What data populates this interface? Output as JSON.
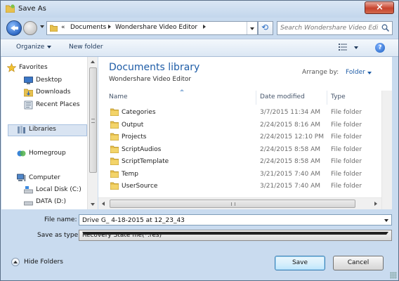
{
  "window": {
    "title": "Save As",
    "close_label": "×"
  },
  "address": {
    "prefix": "«",
    "crumbs": [
      "Documents",
      "Wondershare Video Editor"
    ]
  },
  "search": {
    "placeholder": "Search Wondershare Video Edi..."
  },
  "toolbar": {
    "organize_label": "Organize",
    "new_folder_label": "New folder",
    "help_label": "?"
  },
  "nav": {
    "items": [
      {
        "label": "Favorites",
        "icon": "star-icon"
      },
      {
        "label": "Desktop",
        "icon": "desktop-icon"
      },
      {
        "label": "Downloads",
        "icon": "downloads-folder-icon"
      },
      {
        "label": "Recent Places",
        "icon": "recent-places-icon"
      },
      {
        "label": "Libraries",
        "icon": "libraries-icon"
      },
      {
        "label": "Homegroup",
        "icon": "homegroup-icon"
      },
      {
        "label": "Computer",
        "icon": "computer-icon"
      },
      {
        "label": "Local Disk (C:)",
        "icon": "drive-icon"
      },
      {
        "label": "DATA (D:)",
        "icon": "drive-icon"
      }
    ]
  },
  "library": {
    "title": "Documents library",
    "subtitle": "Wondershare Video Editor",
    "arrange_label": "Arrange by:",
    "arrange_value": "Folder"
  },
  "columns": {
    "name": "Name",
    "date": "Date modified",
    "type": "Type"
  },
  "files": [
    {
      "name": "Categories",
      "date": "3/7/2015 11:34 AM",
      "type": "File folder"
    },
    {
      "name": "Output",
      "date": "2/24/2015 8:16 AM",
      "type": "File folder"
    },
    {
      "name": "Projects",
      "date": "2/24/2015 12:10 PM",
      "type": "File folder"
    },
    {
      "name": "ScriptAudios",
      "date": "2/24/2015 8:58 AM",
      "type": "File folder"
    },
    {
      "name": "ScriptTemplate",
      "date": "2/24/2015 8:58 AM",
      "type": "File folder"
    },
    {
      "name": "Temp",
      "date": "3/21/2015 7:40 AM",
      "type": "File folder"
    },
    {
      "name": "UserSource",
      "date": "3/21/2015 7:40 AM",
      "type": "File folder"
    }
  ],
  "form": {
    "file_name_label": "File name:",
    "file_name_value": "Drive G_ 4-18-2015 at 12_23_43",
    "save_type_label": "Save as type:",
    "save_type_value": "Recovery State file(*.res)"
  },
  "buttons": {
    "hide_folders": "Hide Folders",
    "save": "Save",
    "cancel": "Cancel"
  },
  "colors": {
    "accent": "#1f5da7",
    "chrome": "#c9dbef",
    "close": "#c7432d"
  }
}
